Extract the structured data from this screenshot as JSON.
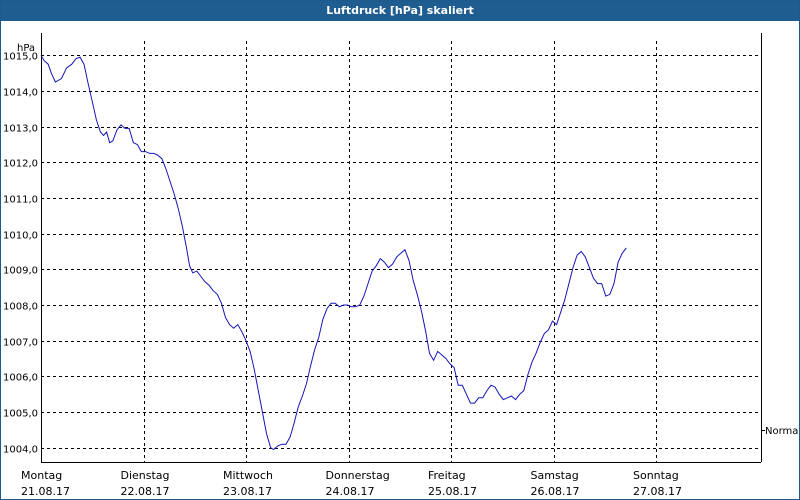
{
  "window": {
    "title": "Luftdruck [hPa] skaliert"
  },
  "chart_data": {
    "type": "line",
    "title": "Luftdruck [hPa] skaliert",
    "ylabel": "hPa",
    "ylim": [
      1003.6,
      1015.4
    ],
    "yticks": [
      "1015,0",
      "1014,0",
      "1013,0",
      "1012,0",
      "1011,0",
      "1010,0",
      "1009,0",
      "1008,0",
      "1007,0",
      "1006,0",
      "1005,0",
      "1004,0"
    ],
    "ytick_values": [
      1015,
      1014,
      1013,
      1012,
      1011,
      1010,
      1009,
      1008,
      1007,
      1006,
      1005,
      1004
    ],
    "xlim_days": [
      0,
      7.2
    ],
    "days": [
      {
        "name": "Montag",
        "date": "21.08.17"
      },
      {
        "name": "Dienstag",
        "date": "22.08.17"
      },
      {
        "name": "Mittwoch",
        "date": "23.08.17"
      },
      {
        "name": "Donnerstag",
        "date": "24.08.17"
      },
      {
        "name": "Freitag",
        "date": "25.08.17"
      },
      {
        "name": "Samstag",
        "date": "26.08.17"
      },
      {
        "name": "Sonntag",
        "date": "27.08.17"
      }
    ],
    "reference_label": "Normal",
    "reference_value": 1004.5,
    "grid": true,
    "line_color": "#1515b8",
    "series": [
      {
        "values": [
          [
            0.0,
            1015.0
          ],
          [
            0.03,
            1014.85
          ],
          [
            0.07,
            1014.75
          ],
          [
            0.1,
            1014.5
          ],
          [
            0.14,
            1014.25
          ],
          [
            0.2,
            1014.35
          ],
          [
            0.25,
            1014.65
          ],
          [
            0.3,
            1014.75
          ],
          [
            0.34,
            1014.9
          ],
          [
            0.38,
            1014.95
          ],
          [
            0.42,
            1014.75
          ],
          [
            0.46,
            1014.2
          ],
          [
            0.5,
            1013.7
          ],
          [
            0.54,
            1013.2
          ],
          [
            0.58,
            1012.85
          ],
          [
            0.61,
            1012.75
          ],
          [
            0.64,
            1012.85
          ],
          [
            0.67,
            1012.55
          ],
          [
            0.7,
            1012.6
          ],
          [
            0.74,
            1012.9
          ],
          [
            0.78,
            1013.05
          ],
          [
            0.82,
            1012.95
          ],
          [
            0.86,
            1012.95
          ],
          [
            0.9,
            1012.55
          ],
          [
            0.94,
            1012.5
          ],
          [
            0.98,
            1012.3
          ],
          [
            1.02,
            1012.3
          ],
          [
            1.06,
            1012.25
          ],
          [
            1.1,
            1012.25
          ],
          [
            1.14,
            1012.2
          ],
          [
            1.18,
            1012.1
          ],
          [
            1.22,
            1011.8
          ],
          [
            1.26,
            1011.45
          ],
          [
            1.3,
            1011.1
          ],
          [
            1.34,
            1010.7
          ],
          [
            1.38,
            1010.2
          ],
          [
            1.42,
            1009.6
          ],
          [
            1.45,
            1009.1
          ],
          [
            1.48,
            1008.9
          ],
          [
            1.52,
            1008.95
          ],
          [
            1.56,
            1008.8
          ],
          [
            1.6,
            1008.65
          ],
          [
            1.64,
            1008.55
          ],
          [
            1.68,
            1008.4
          ],
          [
            1.72,
            1008.3
          ],
          [
            1.76,
            1008.05
          ],
          [
            1.8,
            1007.65
          ],
          [
            1.84,
            1007.45
          ],
          [
            1.88,
            1007.35
          ],
          [
            1.92,
            1007.45
          ],
          [
            1.96,
            1007.25
          ],
          [
            2.0,
            1007.0
          ],
          [
            2.04,
            1006.7
          ],
          [
            2.08,
            1006.2
          ],
          [
            2.12,
            1005.6
          ],
          [
            2.16,
            1005.0
          ],
          [
            2.2,
            1004.4
          ],
          [
            2.24,
            1004.0
          ],
          [
            2.27,
            1003.95
          ],
          [
            2.31,
            1004.05
          ],
          [
            2.35,
            1004.1
          ],
          [
            2.39,
            1004.1
          ],
          [
            2.43,
            1004.3
          ],
          [
            2.47,
            1004.7
          ],
          [
            2.51,
            1005.15
          ],
          [
            2.55,
            1005.45
          ],
          [
            2.59,
            1005.8
          ],
          [
            2.63,
            1006.3
          ],
          [
            2.67,
            1006.75
          ],
          [
            2.71,
            1007.1
          ],
          [
            2.75,
            1007.6
          ],
          [
            2.79,
            1007.9
          ],
          [
            2.83,
            1008.05
          ],
          [
            2.87,
            1008.05
          ],
          [
            2.91,
            1007.95
          ],
          [
            2.95,
            1008.0
          ],
          [
            2.99,
            1008.0
          ],
          [
            3.03,
            1007.95
          ],
          [
            3.07,
            1007.95
          ],
          [
            3.11,
            1008.0
          ],
          [
            3.15,
            1008.25
          ],
          [
            3.19,
            1008.6
          ],
          [
            3.23,
            1008.95
          ],
          [
            3.27,
            1009.1
          ],
          [
            3.31,
            1009.3
          ],
          [
            3.35,
            1009.2
          ],
          [
            3.39,
            1009.05
          ],
          [
            3.43,
            1009.15
          ],
          [
            3.47,
            1009.35
          ],
          [
            3.51,
            1009.45
          ],
          [
            3.55,
            1009.55
          ],
          [
            3.59,
            1009.25
          ],
          [
            3.63,
            1008.7
          ],
          [
            3.67,
            1008.3
          ],
          [
            3.71,
            1007.85
          ],
          [
            3.75,
            1007.3
          ],
          [
            3.79,
            1006.65
          ],
          [
            3.83,
            1006.45
          ],
          [
            3.87,
            1006.7
          ],
          [
            3.91,
            1006.6
          ],
          [
            3.95,
            1006.5
          ],
          [
            3.99,
            1006.35
          ],
          [
            4.03,
            1006.25
          ],
          [
            4.07,
            1005.75
          ],
          [
            4.11,
            1005.75
          ],
          [
            4.15,
            1005.5
          ],
          [
            4.19,
            1005.25
          ],
          [
            4.23,
            1005.25
          ],
          [
            4.27,
            1005.4
          ],
          [
            4.31,
            1005.4
          ],
          [
            4.35,
            1005.6
          ],
          [
            4.39,
            1005.75
          ],
          [
            4.43,
            1005.7
          ],
          [
            4.47,
            1005.5
          ],
          [
            4.51,
            1005.35
          ],
          [
            4.55,
            1005.4
          ],
          [
            4.59,
            1005.45
          ],
          [
            4.63,
            1005.35
          ],
          [
            4.67,
            1005.5
          ],
          [
            4.71,
            1005.6
          ],
          [
            4.75,
            1006.05
          ],
          [
            4.79,
            1006.4
          ],
          [
            4.83,
            1006.65
          ],
          [
            4.87,
            1006.95
          ],
          [
            4.91,
            1007.2
          ],
          [
            4.95,
            1007.3
          ],
          [
            4.99,
            1007.55
          ],
          [
            5.03,
            1007.45
          ],
          [
            5.07,
            1007.8
          ],
          [
            5.11,
            1008.15
          ],
          [
            5.15,
            1008.6
          ],
          [
            5.19,
            1009.05
          ],
          [
            5.23,
            1009.4
          ],
          [
            5.27,
            1009.5
          ],
          [
            5.31,
            1009.35
          ],
          [
            5.35,
            1009.05
          ],
          [
            5.39,
            1008.75
          ],
          [
            5.43,
            1008.6
          ],
          [
            5.47,
            1008.6
          ],
          [
            5.51,
            1008.25
          ],
          [
            5.55,
            1008.3
          ],
          [
            5.59,
            1008.6
          ],
          [
            5.63,
            1009.2
          ],
          [
            5.67,
            1009.45
          ],
          [
            5.71,
            1009.6
          ]
        ]
      }
    ]
  }
}
